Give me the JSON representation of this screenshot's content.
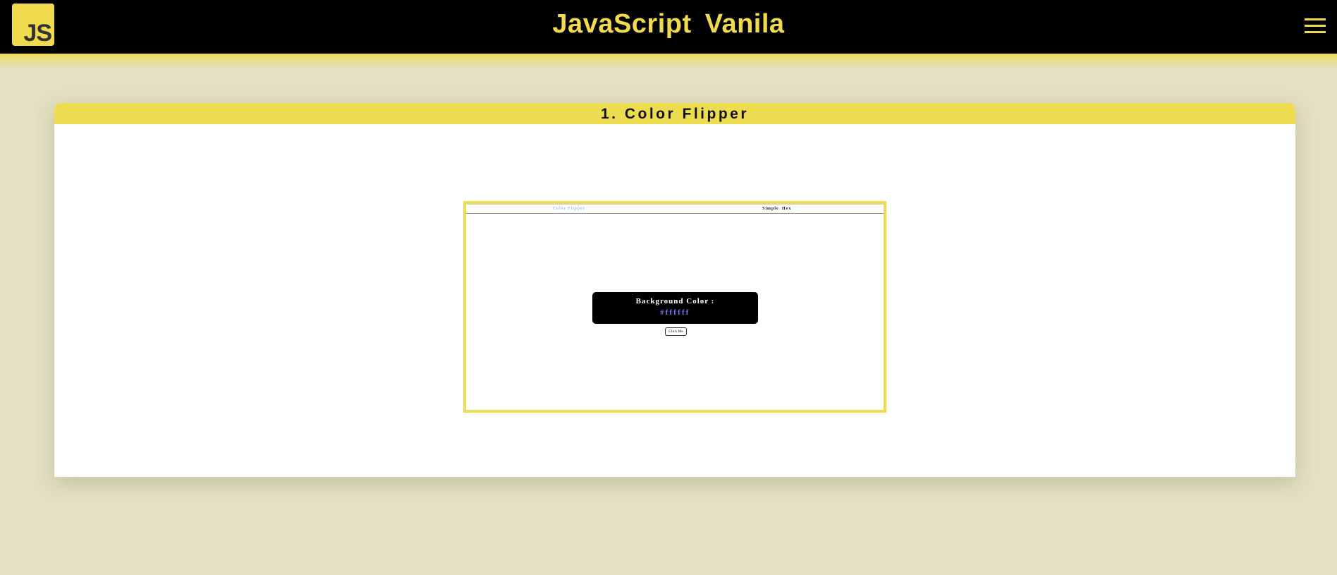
{
  "header": {
    "logo_text": "JS",
    "title": "JavaScript  Vanila",
    "menu_icon": "hamburger-menu-icon",
    "accent_color": "#f0db4f",
    "background_color": "#000000"
  },
  "project": {
    "title": "1. Color Flipper",
    "header_color": "#eedc50",
    "preview": {
      "nav": {
        "brand": "Color Flipper",
        "links": [
          "Simple",
          "Hex"
        ]
      },
      "color_label": "Background Color :",
      "color_value": "#ffffff",
      "button_label": "Click Me"
    }
  },
  "page": {
    "background_color": "#e3e0c3"
  }
}
